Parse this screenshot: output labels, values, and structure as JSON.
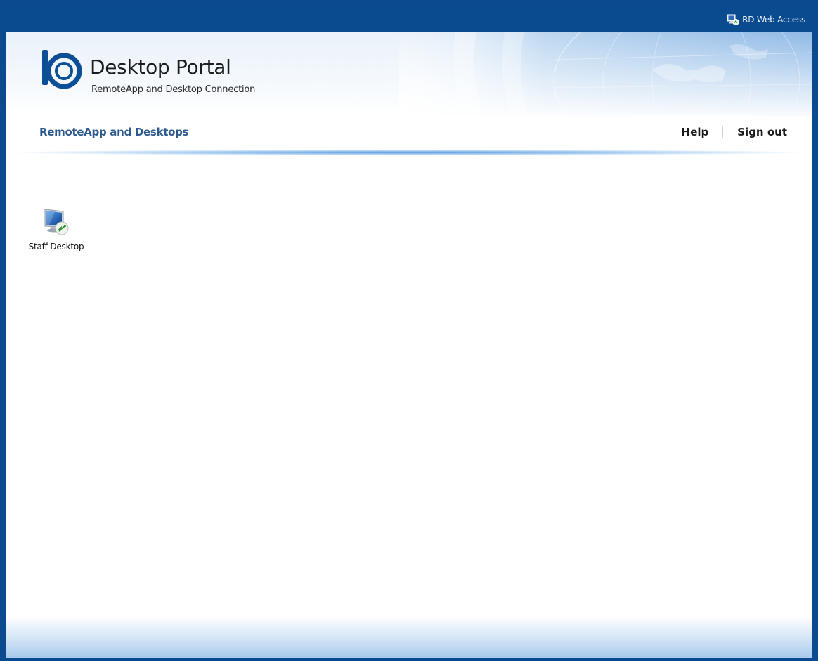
{
  "header": {
    "top_link_label": "RD Web Access",
    "title": "Desktop Portal",
    "subtitle": "RemoteApp and Desktop Connection"
  },
  "nav": {
    "section_title": "RemoteApp and Desktops",
    "help_label": "Help",
    "signout_label": "Sign out"
  },
  "resources": [
    {
      "label": "Staff Desktop",
      "icon": "remote-desktop-icon"
    }
  ],
  "colors": {
    "top_bar": "#0a4b90",
    "nav_title": "#2d5a8c",
    "accent": "#5b9be0"
  }
}
